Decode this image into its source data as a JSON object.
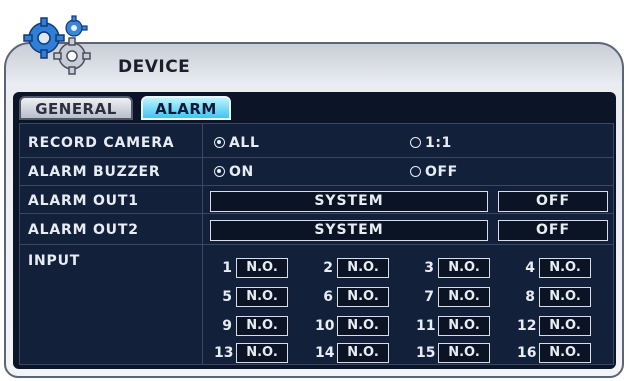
{
  "window": {
    "title": "DEVICE",
    "logo_icon": "gears-icon"
  },
  "tabs": [
    {
      "label": "GENERAL",
      "active": false
    },
    {
      "label": "ALARM",
      "active": true
    }
  ],
  "record_camera": {
    "label": "RECORD CAMERA",
    "options": [
      {
        "label": "ALL",
        "selected": true
      },
      {
        "label": "1:1",
        "selected": false
      }
    ]
  },
  "alarm_buzzer": {
    "label": "ALARM BUZZER",
    "options": [
      {
        "label": "ON",
        "selected": true
      },
      {
        "label": "OFF",
        "selected": false
      }
    ]
  },
  "alarm_out1": {
    "label": "ALARM OUT1",
    "source": "SYSTEM",
    "state": "OFF"
  },
  "alarm_out2": {
    "label": "ALARM OUT2",
    "source": "SYSTEM",
    "state": "OFF"
  },
  "input": {
    "label": "INPUT",
    "channels": [
      {
        "num": "1",
        "value": "N.O."
      },
      {
        "num": "2",
        "value": "N.O."
      },
      {
        "num": "3",
        "value": "N.O."
      },
      {
        "num": "4",
        "value": "N.O."
      },
      {
        "num": "5",
        "value": "N.O."
      },
      {
        "num": "6",
        "value": "N.O."
      },
      {
        "num": "7",
        "value": "N.O."
      },
      {
        "num": "8",
        "value": "N.O."
      },
      {
        "num": "9",
        "value": "N.O."
      },
      {
        "num": "10",
        "value": "N.O."
      },
      {
        "num": "11",
        "value": "N.O."
      },
      {
        "num": "12",
        "value": "N.O."
      },
      {
        "num": "13",
        "value": "N.O."
      },
      {
        "num": "14",
        "value": "N.O."
      },
      {
        "num": "15",
        "value": "N.O."
      },
      {
        "num": "16",
        "value": "N.O."
      }
    ]
  },
  "colors": {
    "panel": "#0c1527",
    "grid": "#12203a",
    "active_tab": "#3fc6ee",
    "text": "#e8ecf5"
  }
}
